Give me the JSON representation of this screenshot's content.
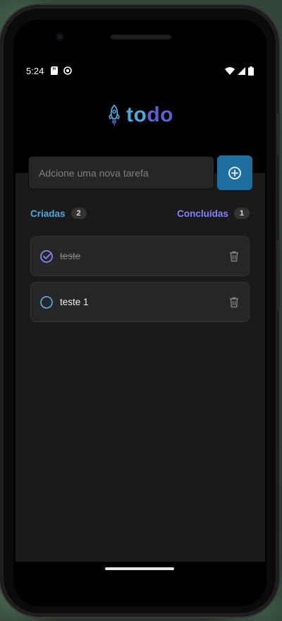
{
  "status_bar": {
    "time": "5:24",
    "icons_left": [
      "sd-card-icon",
      "sync-icon"
    ],
    "icons_right": [
      "wifi-icon",
      "signal-icon",
      "battery-icon"
    ]
  },
  "header": {
    "logo_icon": "rocket-icon",
    "title_first": "to",
    "title_rest": "do"
  },
  "new_task": {
    "placeholder": "Adcione uma nova tarefa",
    "value": "",
    "add_button_icon": "plus-circle-icon"
  },
  "counters": {
    "created_label": "Criadas",
    "created_count": "2",
    "completed_label": "Concluídas",
    "completed_count": "1"
  },
  "tasks": [
    {
      "text": "teste",
      "completed": true
    },
    {
      "text": "teste 1",
      "completed": false
    }
  ],
  "colors": {
    "brand_blue": "#4ea8de",
    "brand_purple": "#8284fa",
    "add_button": "#1e6f9f",
    "background": "#1a1a1a",
    "card": "#262626"
  }
}
